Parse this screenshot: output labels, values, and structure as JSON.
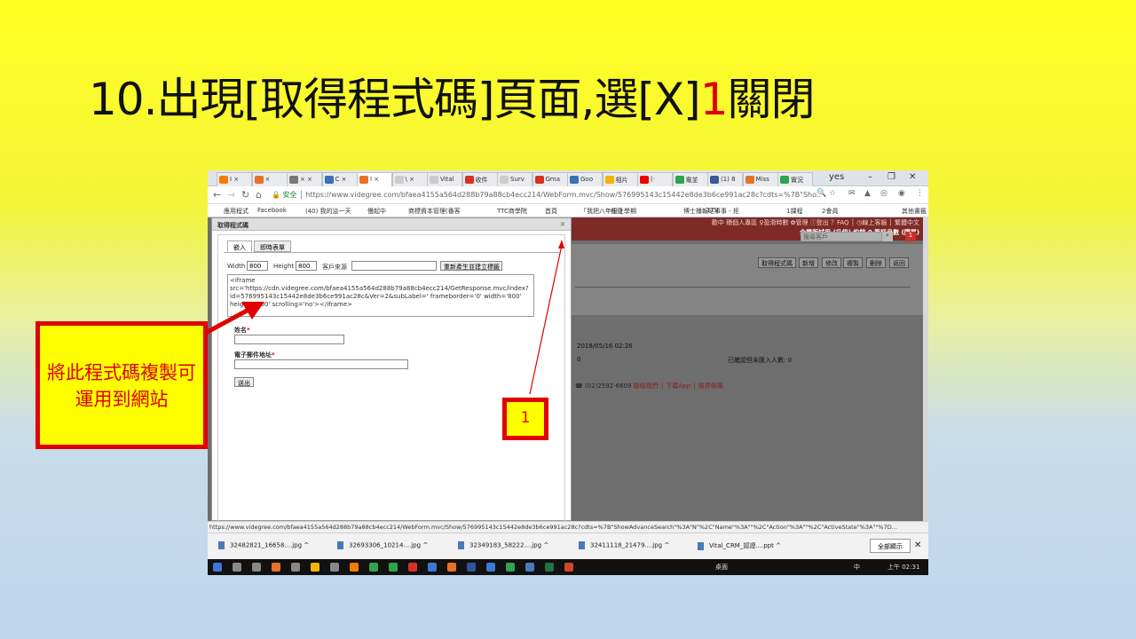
{
  "slide": {
    "title_main": "10.出現[取得程式碼]頁面,選[X]",
    "title_num": "1",
    "title_end": "關閉",
    "callout": "將此程式碼複製可運用到網站",
    "badge": "1"
  },
  "browser": {
    "tabs": [
      {
        "label": "Ⅰ ×",
        "color": "#f57c00"
      },
      {
        "label": "×",
        "color": "#e8712a"
      },
      {
        "label": "× ×",
        "color": "#777"
      },
      {
        "label": "C ×",
        "color": "#3b6fb6"
      },
      {
        "label": "Ⅰ ×",
        "color": "#e8712a"
      },
      {
        "label": "\\ ×",
        "color": "#ccc"
      },
      {
        "label": "Vital",
        "color": "#ccc"
      },
      {
        "label": "收件",
        "color": "#d93025"
      },
      {
        "label": "Surv",
        "color": "#ccc"
      },
      {
        "label": "Gma",
        "color": "#d93025"
      },
      {
        "label": "Goo",
        "color": "#3b6fb6"
      },
      {
        "label": "相片",
        "color": "#f4b400"
      },
      {
        "label": "(·",
        "color": "#e00"
      },
      {
        "label": "電並",
        "color": "#2ea44f"
      },
      {
        "label": "(1) 8",
        "color": "#3b5998"
      },
      {
        "label": "Miss",
        "color": "#e8712a"
      },
      {
        "label": "實況",
        "color": "#2ea44f"
      }
    ],
    "user": "yes",
    "security": "安全",
    "url": "https://www.videgree.com/bfaea4155a564d288b79a88cb4ecc214/WebForm.mvc/Show/576995143c15442e8de3b6ce991ac28c?cdts=%7B\"Sho...",
    "bookmarks": [
      "應用程式",
      "Facebook",
      "(40) 我的這一天",
      "慢起中",
      "商標資本管理(番客",
      "TTC商學院",
      "首頁",
      "「我把八年級上學期",
      "任哥",
      "博士播報站事事 - 拒",
      "1TV",
      "1課程",
      "2會員",
      "其他書籤"
    ]
  },
  "site": {
    "top_links": "歡中 積個人專區 ♀盈滑時數 ✿管理 ⓘ登出 ？FAQ │ ◷線上客服 │ 繁體中文",
    "trial": "企業版試用 (升級) 約餘 0 筆訊息數 (購買)",
    "search_placeholder": "搜尋客戶",
    "buttons": [
      "取得程式碼",
      "新增",
      "修改",
      "複製",
      "刪除",
      "返回"
    ],
    "date": "2018/05/16 02:26",
    "zero": "0",
    "confirm_text": "已確認但未匯入人數: 0",
    "footer_phone": "(02)2592-6609",
    "footer_links": "聯絡我們 │ 下載App │ 條界條羅"
  },
  "dialog": {
    "title": "取得程式碼",
    "tab_embed": "嵌入",
    "tab_instant": "即時表單",
    "width_label": "Width",
    "width_value": "800",
    "height_label": "Height",
    "height_value": "800",
    "source_label": "客戶來源",
    "regen_button": "重新產生並建立標籤",
    "code": "<iframe src='https://cdn.videgree.com/bfaea4155a564d288b79a88cb4ecc214/GetResponse.mvc/index?id=576995143c15442e8de3b6ce991ac28c&Ver=2&subLabel=' frameborder='0' width='800' height='800' scrolling='no'></iframe>",
    "name_label": "姓名",
    "email_label": "電子郵件地址",
    "req": "*",
    "submit": "送出"
  },
  "status_url": "https://www.videgree.com/bfaea4155a564d288b79a88cb4ecc214/WebForm.mvc/Show/576995143c15442e8de3b6ce991ac28c?cdts=%7B\"ShowAdvanceSearch\"%3A\"N\"%2C\"Name\"%3A\"\"%2C\"Action\"%3A\"\"%2C\"ActiveState\"%3A\"\"%7D...",
  "downloads": {
    "items": [
      "32482821_16658....jpg",
      "32693306_10214....jpg",
      "32349183_58222....jpg",
      "32411118_21479....jpg",
      "Vital_CRM_認證....ppt"
    ],
    "show_all": "全部顯示"
  },
  "taskbar": {
    "desktop": "桌面",
    "ime": "中",
    "time": "上午 02:31"
  }
}
